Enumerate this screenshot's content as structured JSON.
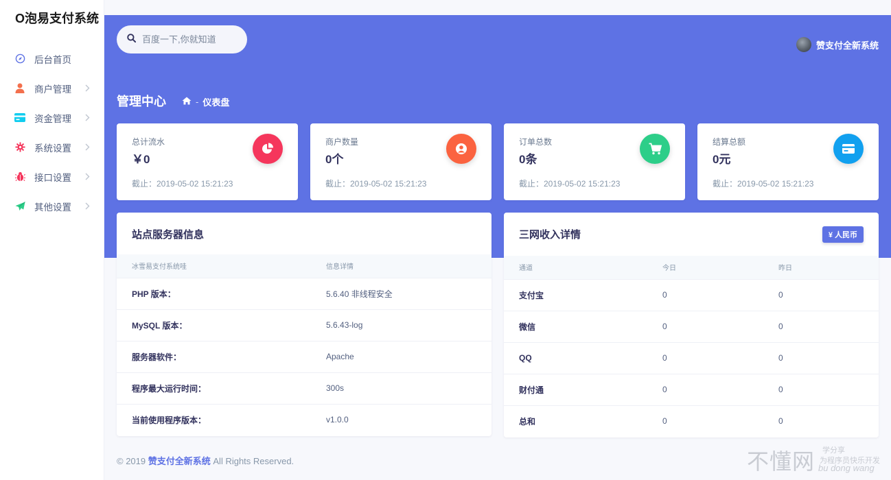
{
  "brand": "O泡易支付系统",
  "nav": [
    {
      "label": "后台首页",
      "icon": "compass-icon",
      "color": "#5e72e4",
      "chevron": false
    },
    {
      "label": "商户管理",
      "icon": "user-icon",
      "color": "#f3704d",
      "chevron": true
    },
    {
      "label": "资金管理",
      "icon": "card-icon",
      "color": "#11cdef",
      "chevron": true
    },
    {
      "label": "系统设置",
      "icon": "gear-icon",
      "color": "#f5365c",
      "chevron": true
    },
    {
      "label": "接口设置",
      "icon": "bug-icon",
      "color": "#f5365c",
      "chevron": true
    },
    {
      "label": "其他设置",
      "icon": "send-icon",
      "color": "#2dce89",
      "chevron": true
    }
  ],
  "search": {
    "placeholder": "百度一下,你就知道"
  },
  "user": {
    "name": "赞支付全新系统"
  },
  "header": {
    "title": "管理中心",
    "breadcrumb_sep": "-",
    "breadcrumb_current": "仪表盘"
  },
  "stats": [
    {
      "label": "总计流水",
      "value": "￥0",
      "date": "截止：2019-05-02 15:21:23",
      "icon": "pie-chart-icon",
      "color": "#f5365c"
    },
    {
      "label": "商户数量",
      "value": "0个",
      "date": "截止：2019-05-02 15:21:23",
      "icon": "user-circle-icon",
      "color": "#fb6340"
    },
    {
      "label": "订单总数",
      "value": "0条",
      "date": "截止：2019-05-02 15:21:23",
      "icon": "cart-icon",
      "color": "#2dce89"
    },
    {
      "label": "结算总额",
      "value": "0元",
      "date": "截止：2019-05-02 15:21:23",
      "icon": "wallet-icon",
      "color": "#11cdef"
    }
  ],
  "server": {
    "title": "站点服务器信息",
    "headers": [
      "冰雪易支付系统哇",
      "信息详情"
    ],
    "rows": [
      [
        "PHP 版本：",
        "5.6.40 非线程安全"
      ],
      [
        "MySQL 版本：",
        "5.6.43-log"
      ],
      [
        "服务器软件：",
        "Apache"
      ],
      [
        "程序最大运行时间：",
        "300s"
      ],
      [
        "当前使用程序版本：",
        "v1.0.0"
      ]
    ]
  },
  "income": {
    "title": "三网收入详情",
    "button": "¥ 人民币",
    "headers": [
      "通道",
      "今日",
      "昨日"
    ],
    "rows": [
      [
        "支付宝",
        "0",
        "0"
      ],
      [
        "微信",
        "0",
        "0"
      ],
      [
        "QQ",
        "0",
        "0"
      ],
      [
        "财付通",
        "0",
        "0"
      ],
      [
        "总和",
        "0",
        "0"
      ]
    ]
  },
  "footer": {
    "prefix": "© 2019",
    "brand": "赞支付全新系统",
    "suffix": "All Rights Reserved."
  },
  "watermark": {
    "main": "不懂网",
    "top": "学分享",
    "sub": "为程序员快乐开发",
    "roman": "bu dong wang"
  }
}
